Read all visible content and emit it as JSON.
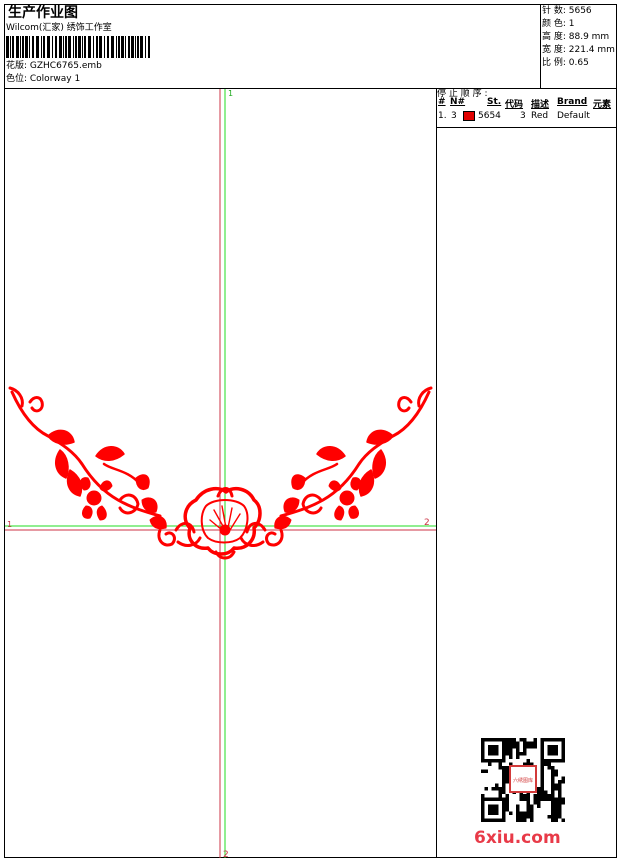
{
  "header": {
    "title": "生产作业图",
    "studio": "Wilcom(汇家)  绣饰工作室",
    "design_name": "花版:  GZHC6765.emb",
    "colorway": "色位:  Colorway 1"
  },
  "stats": {
    "stitches": "针 数:  5656",
    "colors": "颜 色:  1",
    "height": "高 度:  88.9 mm",
    "width": "宽 度:  221.4 mm",
    "scale": "比 例:  0.65"
  },
  "stop_sequence": {
    "heading": "停 止 顺 序 :",
    "columns": [
      "#",
      "N#",
      "St.",
      "代码",
      "描述",
      "Brand",
      "元素"
    ],
    "rows": [
      {
        "index": "1.",
        "needle": "3",
        "swatch_color": "#e00000",
        "stitches": "5654",
        "code": "3",
        "description": "Red",
        "brand": "Default"
      }
    ]
  },
  "axes": {
    "top_marker": "1",
    "left_marker": "1",
    "right_marker": "2",
    "bottom_marker": "2"
  },
  "embroidery": {
    "thread_color": "#ff0000"
  },
  "watermark": {
    "text": "6xiu.com",
    "stamp_text": "六绣图库"
  }
}
